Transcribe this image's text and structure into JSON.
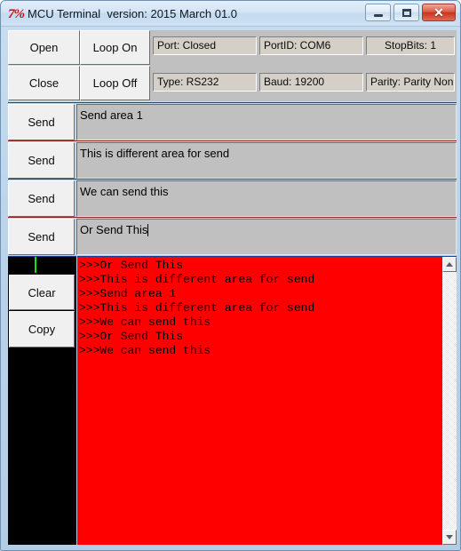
{
  "window": {
    "title": "MCU Terminal  version: 2015 March 01.0",
    "icon": "7%",
    "controls": {
      "minimize": "minimize-icon",
      "maximize": "maximize-icon",
      "close": "✕"
    }
  },
  "toolbar": {
    "open_label": "Open",
    "close_label": "Close",
    "loop_on_label": "Loop On",
    "loop_off_label": "Loop Off"
  },
  "status": {
    "port": "Port: Closed",
    "port_id": "PortID: COM6",
    "stop_bits": "StopBits: 1",
    "type": "Type: RS232",
    "baud": "Baud: 19200",
    "parity": "Parity: Parity None"
  },
  "send_rows": [
    {
      "button": "Send",
      "text": "Send area 1"
    },
    {
      "button": "Send",
      "text": "This is different area for send"
    },
    {
      "button": "Send",
      "text": "We can send this"
    },
    {
      "button": "Send",
      "text": "Or Send This"
    }
  ],
  "side_panel": {
    "clear_label": "Clear",
    "copy_label": "Copy"
  },
  "terminal": {
    "lines": [
      ">>>Or Send This",
      ">>>This is different area for send",
      ">>>Send area 1",
      ">>>This is different area for send",
      ">>>We can send this",
      ">>>Or Send This",
      ">>>We can send this"
    ],
    "background_color": "#ff0000",
    "text_color": "#000000"
  },
  "colors": {
    "terminal_red": "#ff0000",
    "panel_black": "#000000",
    "marker_green": "#12e312",
    "row_divider_red": "#8d2020",
    "close_button_red": "#c8341f"
  }
}
